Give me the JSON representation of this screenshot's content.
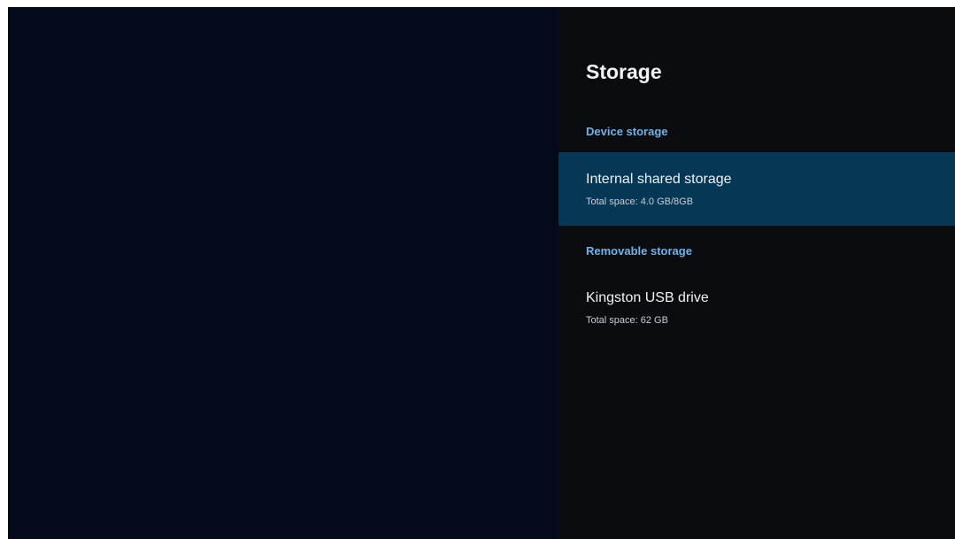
{
  "panel": {
    "title": "Storage",
    "sections": [
      {
        "header": "Device storage",
        "items": [
          {
            "title": "Internal shared storage",
            "subtitle": "Total space: 4.0 GB/8GB",
            "focused": true
          }
        ]
      },
      {
        "header": "Removable storage",
        "items": [
          {
            "title": "Kingston USB drive",
            "subtitle": "Total space: 62 GB",
            "focused": false
          }
        ]
      }
    ]
  },
  "colors": {
    "background": "#050a1a",
    "panel": "#0b0c10",
    "focus": "#053756",
    "section_header": "#6fb3e8",
    "text": "#f2f2f2"
  }
}
